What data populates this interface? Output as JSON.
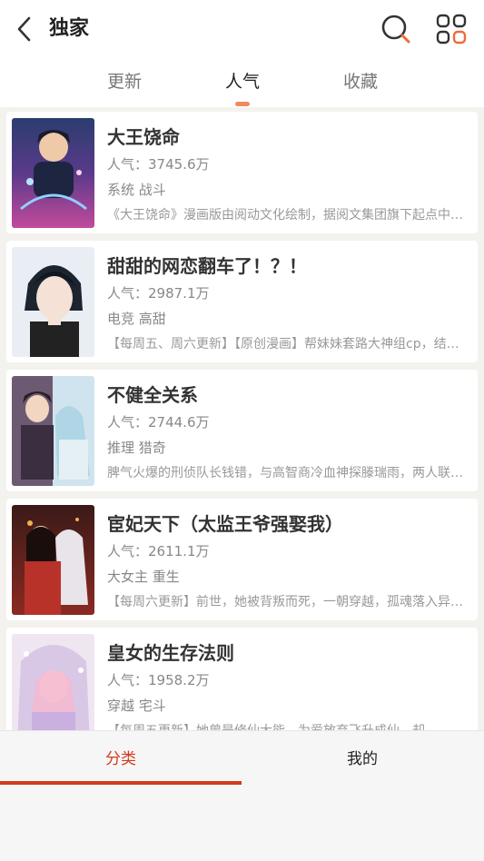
{
  "header": {
    "title": "独家",
    "accent_color": "#f06a3a"
  },
  "tabs": [
    {
      "label": "更新",
      "active": false
    },
    {
      "label": "人气",
      "active": true
    },
    {
      "label": "收藏",
      "active": false
    }
  ],
  "comics": [
    {
      "title": "大王饶命",
      "popularity": "人气：3745.6万",
      "tags": "系统 战斗",
      "description": "《大王饶命》漫画版由阅动文化绘制，据阅文集团旗下起点中文网同名小说改编"
    },
    {
      "title": "甜甜的网恋翻车了！？！",
      "popularity": "人气：2987.1万",
      "tags": "电竞 高甜",
      "description": "【每周五、周六更新】【原创漫画】帮妹妹套路大神组cp，结果网恋翻车了"
    },
    {
      "title": "不健全关系",
      "popularity": "人气：2744.6万",
      "tags": "推理 猎奇",
      "description": "脾气火爆的刑侦队长钱错，与高智商冷血神探滕瑞雨，两人联手破解离奇案件"
    },
    {
      "title": "宦妃天下（太监王爷强娶我）",
      "popularity": "人气：2611.1万",
      "tags": "大女主 重生",
      "description": "【每周六更新】前世，她被背叛而死，一朝穿越，孤魂落入异世之中"
    },
    {
      "title": "皇女的生存法则",
      "popularity": "人气：1958.2万",
      "tags": "穿越 宅斗",
      "description": "【每周五更新】她曾是修仙大能，为爱放弃飞升成仙，却"
    }
  ],
  "bottom_nav": [
    {
      "label": "分类",
      "active": true
    },
    {
      "label": "我的",
      "active": false
    }
  ]
}
